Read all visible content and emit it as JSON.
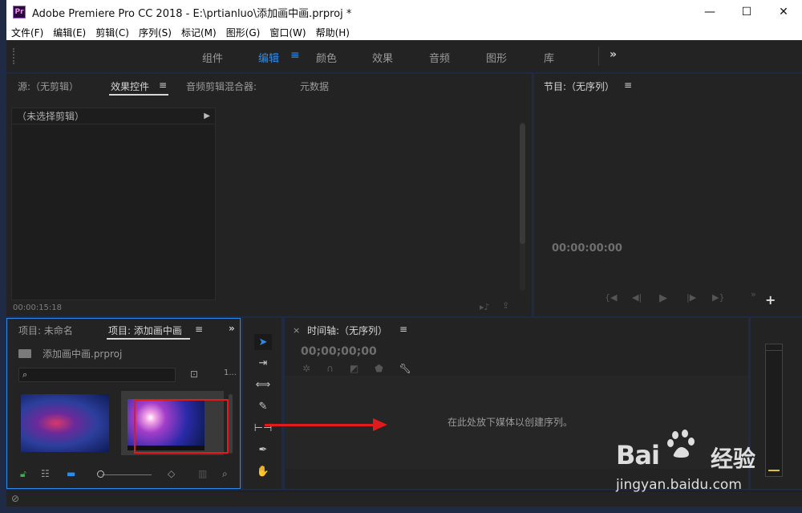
{
  "window": {
    "app_icon": "Pr",
    "title": "Adobe Premiere Pro CC 2018 - E:\\prtianluo\\添加画中画.prproj *",
    "minimize": "—",
    "maximize": "☐",
    "close": "✕"
  },
  "menu": [
    "文件(F)",
    "编辑(E)",
    "剪辑(C)",
    "序列(S)",
    "标记(M)",
    "图形(G)",
    "窗口(W)",
    "帮助(H)"
  ],
  "workspaces": {
    "tabs": [
      "组件",
      "编辑",
      "颜色",
      "效果",
      "音频",
      "图形",
      "库"
    ],
    "active": "编辑",
    "more": "»"
  },
  "source_panel": {
    "tabs": [
      "源:（无剪辑）",
      "效果控件",
      "音频剪辑混合器:",
      "元数据"
    ],
    "active_tab": "效果控件",
    "menu_icon": "≡",
    "no_clip": "（未选择剪辑）",
    "timecode": "00:00:15:18"
  },
  "program_panel": {
    "title": "节目:（无序列）",
    "menu_icon": "≡",
    "timecode": "00:00:00:00",
    "more": "»",
    "add": "+"
  },
  "project_panel": {
    "tabs": [
      "项目: 未命名",
      "项目: 添加画中画"
    ],
    "active_tab": "项目: 添加画中画",
    "menu_icon": "≡",
    "more": "»",
    "file_name": "添加画中画.prproj",
    "count": "1..."
  },
  "timeline_panel": {
    "close": "×",
    "title": "时间轴:（无序列）",
    "menu_icon": "≡",
    "timecode": "00;00;00;00",
    "drop_hint": "在此处放下媒体以创建序列。"
  },
  "watermark": {
    "logo_left": "Bai",
    "logo_right": "经验",
    "url": "jingyan.baidu.com"
  },
  "colors": {
    "accent": "#2d8ceb",
    "annotation": "#e11b1b"
  }
}
